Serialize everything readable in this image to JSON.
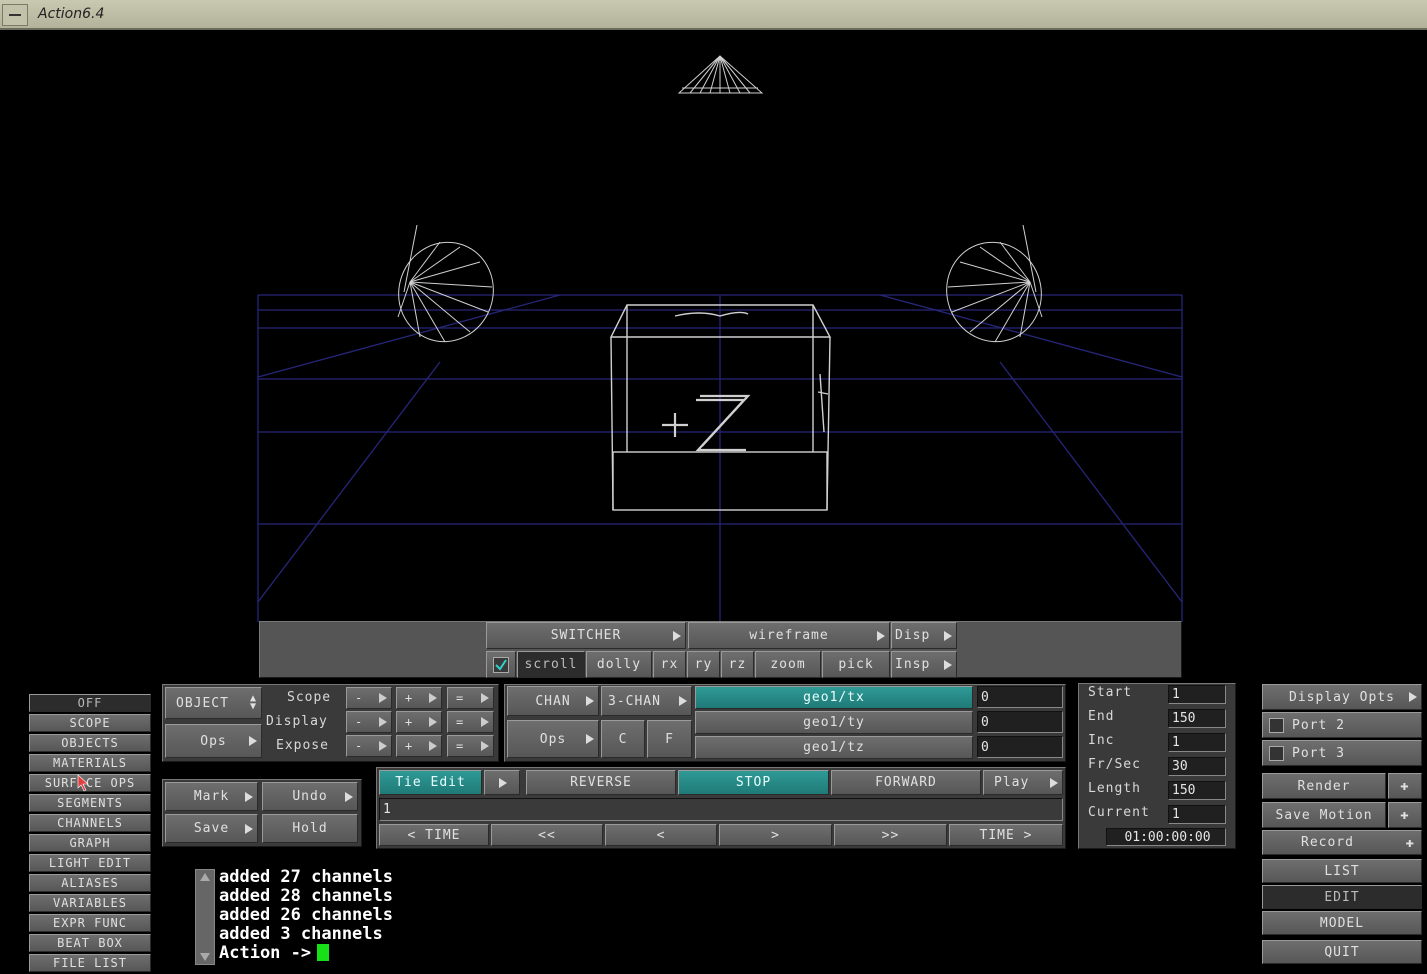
{
  "window": {
    "title": "Action6.4"
  },
  "viewport": {
    "cube_label": "+Z",
    "wire_color": "#d0d0d0",
    "grid_color": "#2a2a80"
  },
  "toolbar": {
    "switcher": "SWITCHER",
    "shading": "wireframe",
    "disp": "Disp",
    "insp": "Insp",
    "scroll_checked": true,
    "scroll": "scroll",
    "dolly": "dolly",
    "rx": "rx",
    "ry": "ry",
    "rz": "rz",
    "zoom": "zoom",
    "pick": "pick"
  },
  "left_menu": {
    "items": [
      "OFF",
      "SCOPE",
      "OBJECTS",
      "MATERIALS",
      "SURFACE OPS",
      "SEGMENTS",
      "CHANNELS",
      "GRAPH",
      "LIGHT EDIT",
      "ALIASES",
      "VARIABLES",
      "EXPR FUNC",
      "BEAT BOX",
      "FILE LIST"
    ],
    "active": "OFF"
  },
  "object_panel": {
    "object": "OBJECT",
    "ops": "Ops",
    "rows": [
      {
        "label": "Scope",
        "minus": "-",
        "plus": "+",
        "eq": "="
      },
      {
        "label": "Display",
        "minus": "-",
        "plus": "+",
        "eq": "="
      },
      {
        "label": "Expose",
        "minus": "-",
        "plus": "+",
        "eq": "="
      }
    ]
  },
  "chan_panel": {
    "chan": "CHAN",
    "three_chan": "3-CHAN",
    "ops": "Ops",
    "c": "C",
    "f": "F",
    "channels": [
      {
        "name": "geo1/tx",
        "value": "0",
        "selected": true
      },
      {
        "name": "geo1/ty",
        "value": "0",
        "selected": false
      },
      {
        "name": "geo1/tz",
        "value": "0",
        "selected": false
      }
    ]
  },
  "edit_panel": {
    "mark": "Mark",
    "undo": "Undo",
    "save": "Save",
    "hold": "Hold"
  },
  "transport": {
    "tie_edit": "Tie Edit",
    "reverse": "REVERSE",
    "stop": "STOP",
    "forward": "FORWARD",
    "play": "Play",
    "frame_field": "1",
    "time_back": "< TIME",
    "rewind": "<<",
    "step_back": "<",
    "step_fwd": ">",
    "fast_fwd": ">>",
    "time_fwd": "TIME >"
  },
  "timing": {
    "start_label": "Start",
    "start": "1",
    "end_label": "End",
    "end": "150",
    "inc_label": "Inc",
    "inc": "1",
    "fps_label": "Fr/Sec",
    "fps": "30",
    "length_label": "Length",
    "length": "150",
    "current_label": "Current",
    "current": "1",
    "timecode": "01:00:00:00"
  },
  "right_panel": {
    "display_opts": "Display Opts",
    "port2": "Port 2",
    "port3": "Port 3",
    "render": "Render",
    "save_motion": "Save Motion",
    "record": "Record",
    "list": "LIST",
    "edit": "EDIT",
    "model": "MODEL",
    "quit": "QUIT"
  },
  "console": {
    "lines": [
      "added 27 channels",
      "added 28 channels",
      "added 26 channels",
      "added 3 channels"
    ],
    "prompt": "Action ->"
  }
}
